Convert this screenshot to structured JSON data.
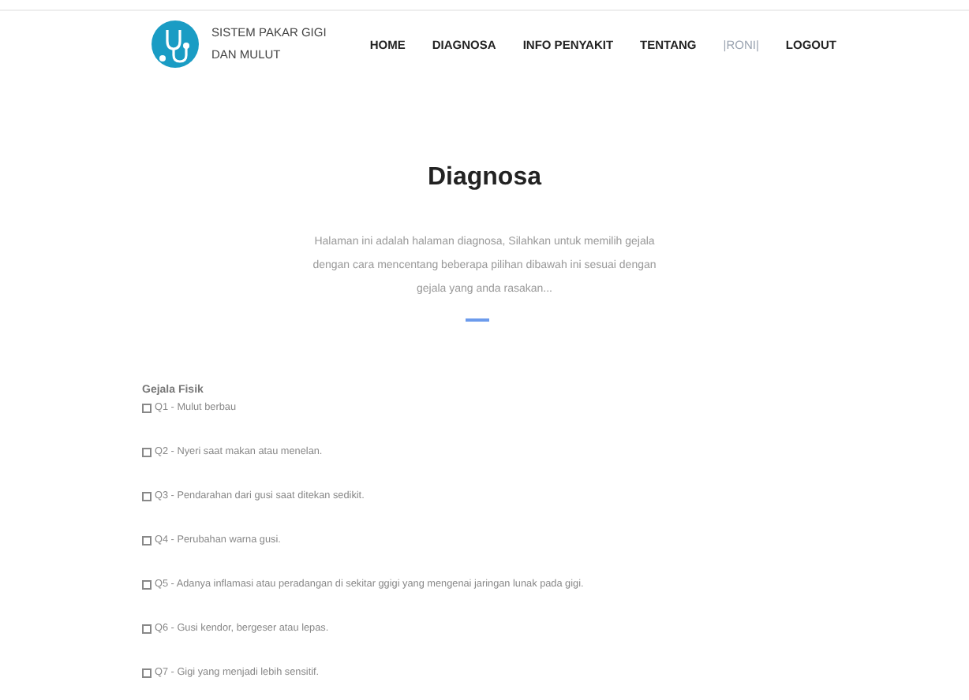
{
  "brand": {
    "line_1": "SISTEM PAKAR GIGI",
    "line_2": "DAN MULUT"
  },
  "nav": [
    {
      "label": "HOME",
      "kind": "link"
    },
    {
      "label": "DIAGNOSA",
      "kind": "link"
    },
    {
      "label": "INFO PENYAKIT",
      "kind": "link"
    },
    {
      "label": "TENTANG",
      "kind": "link"
    },
    {
      "label": "|RONI|",
      "kind": "user"
    },
    {
      "label": "LOGOUT",
      "kind": "link"
    }
  ],
  "heading": "Diagnosa",
  "intro": "Halaman ini adalah halaman diagnosa, Silahkan untuk memilih gejala dengan cara mencentang beberapa pilihan dibawah ini sesuai dengan gejala yang anda rasakan...",
  "section": "Gejala Fisik",
  "symptoms": [
    {
      "label": "Q1 - Mulut berbau",
      "checked": false
    },
    {
      "label": "Q2 - Nyeri saat makan atau menelan.",
      "checked": false
    },
    {
      "label": "Q3 - Pendarahan dari gusi saat ditekan sedikit.",
      "checked": false
    },
    {
      "label": "Q4 - Perubahan warna gusi.",
      "checked": false
    },
    {
      "label": "Q5 - Adanya inflamasi atau peradangan di sekitar ggigi yang mengenai jaringan lunak pada gigi.",
      "checked": false
    },
    {
      "label": "Q6 - Gusi kendor, bergeser atau lepas.",
      "checked": false
    },
    {
      "label": "Q7 - Gigi yang menjadi lebih sensitif.",
      "checked": false
    }
  ]
}
